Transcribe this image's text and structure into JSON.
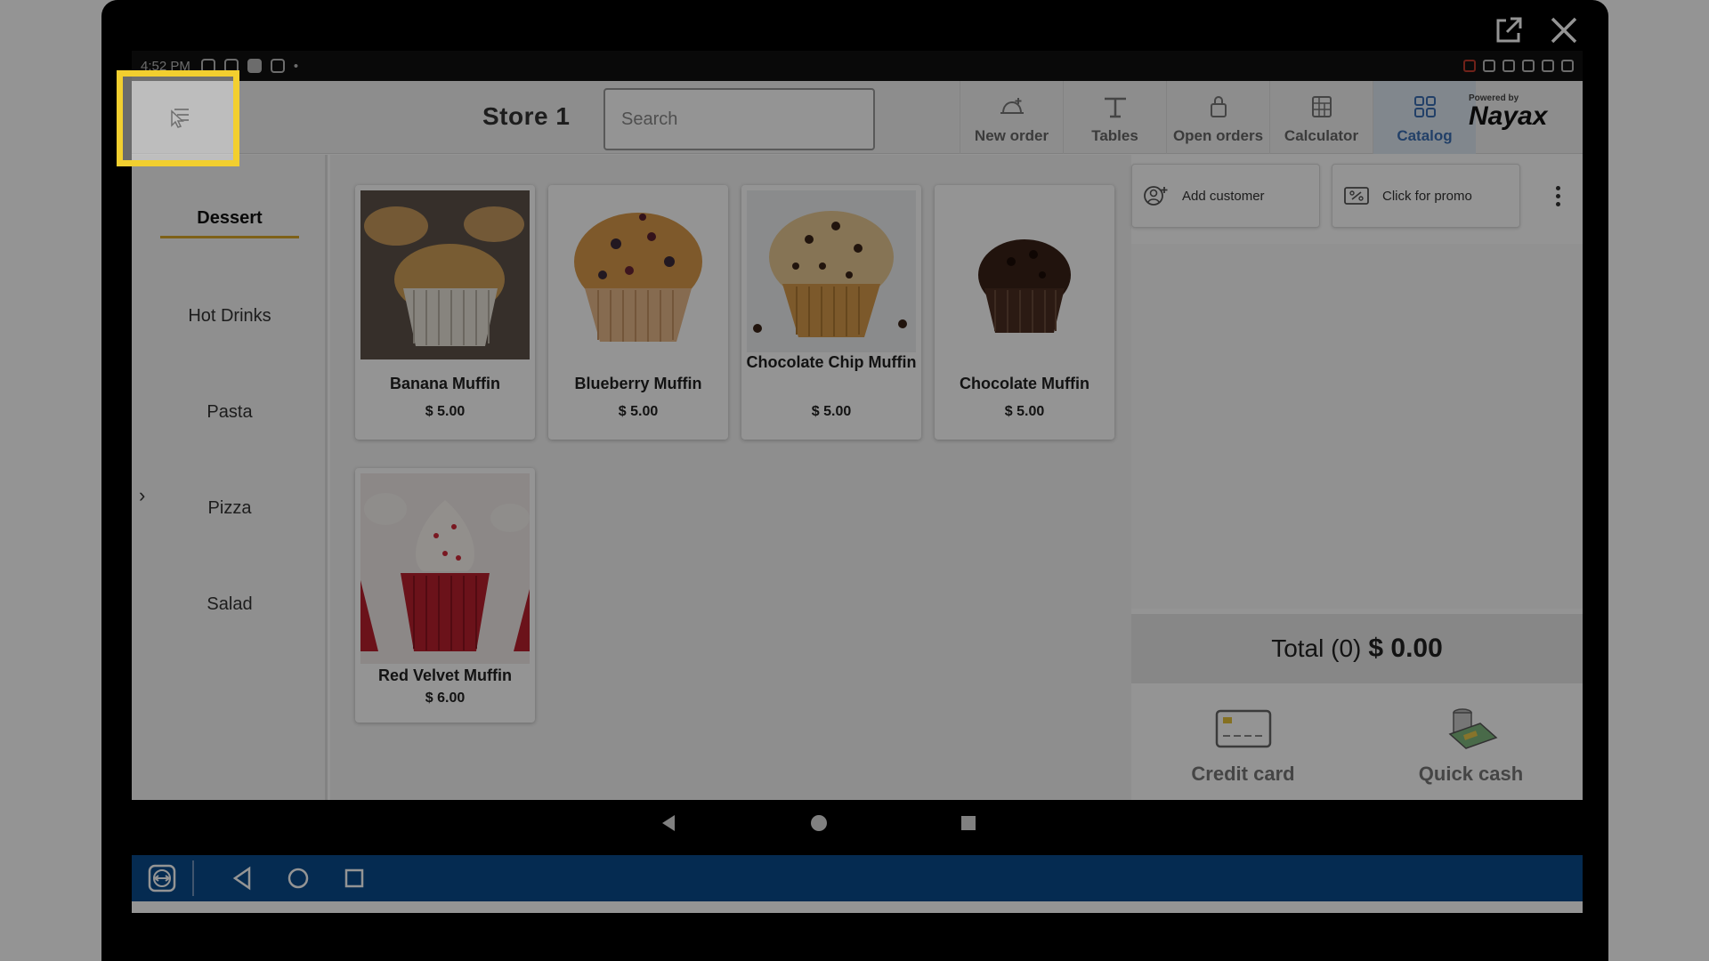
{
  "statusbar": {
    "time": "4:52 PM"
  },
  "appbar": {
    "store_title": "Store 1",
    "search_placeholder": "Search",
    "nav": [
      {
        "label": "New order",
        "icon": "new-order-icon"
      },
      {
        "label": "Tables",
        "icon": "table-icon"
      },
      {
        "label": "Open orders",
        "icon": "lock-icon"
      },
      {
        "label": "Calculator",
        "icon": "calculator-icon"
      },
      {
        "label": "Catalog",
        "icon": "grid-icon",
        "active": true
      }
    ],
    "brand_powered": "Powered by",
    "brand_name": "Nayax"
  },
  "sidebar": {
    "categories": [
      "Dessert",
      "Hot Drinks",
      "Pasta",
      "Pizza",
      "Salad"
    ],
    "active": "Dessert"
  },
  "products": [
    {
      "name": "Banana Muffin",
      "price": "$ 5.00"
    },
    {
      "name": "Blueberry Muffin",
      "price": "$ 5.00"
    },
    {
      "name": "Chocolate Chip Muffin",
      "price": "$ 5.00"
    },
    {
      "name": "Chocolate Muffin",
      "price": "$ 5.00"
    },
    {
      "name": "Red Velvet Muffin",
      "price": "$ 6.00"
    }
  ],
  "order": {
    "add_customer": "Add customer",
    "promo": "Click for promo",
    "total_label": "Total (0)",
    "total_value": "$ 0.00",
    "credit_card": "Credit card",
    "quick_cash": "Quick cash"
  },
  "colors": {
    "highlight": "#f2cf2f",
    "active_tab": "#3b6fb3",
    "tab_underline": "#d9a72a",
    "remote_bar": "#0a4a8c"
  }
}
